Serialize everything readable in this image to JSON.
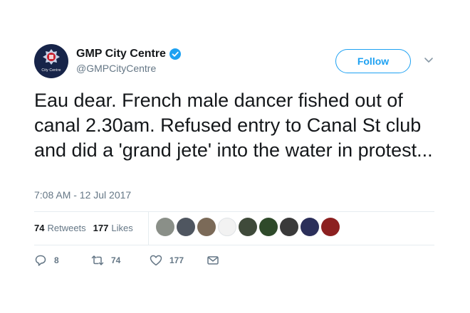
{
  "account": {
    "display_name": "GMP City Centre",
    "handle": "@GMPCityCentre",
    "avatar_text": "City Centre",
    "verified": true
  },
  "follow_button": {
    "label": "Follow"
  },
  "tweet": {
    "text": "Eau dear. French male dancer fished out of canal 2.30am. Refused entry to Canal St club and did a 'grand jete' into the water in protest...",
    "timestamp": "7:08 AM - 12 Jul 2017"
  },
  "stats": {
    "retweets_count": "74",
    "retweets_label": "Retweets",
    "likes_count": "177",
    "likes_label": "Likes"
  },
  "likers": [
    {
      "name": "liker-avatar-1",
      "color": "#8a8f88"
    },
    {
      "name": "liker-avatar-2",
      "color": "#4f5660"
    },
    {
      "name": "liker-avatar-3",
      "color": "#7b6a58"
    },
    {
      "name": "liker-avatar-4",
      "color": "#f2f2f2"
    },
    {
      "name": "liker-avatar-5",
      "color": "#3f4a3a"
    },
    {
      "name": "liker-avatar-6",
      "color": "#2f4a2a"
    },
    {
      "name": "liker-avatar-7",
      "color": "#3a3a3a"
    },
    {
      "name": "liker-avatar-8",
      "color": "#2b2f5a"
    },
    {
      "name": "liker-avatar-9",
      "color": "#8c2020"
    }
  ],
  "actions": {
    "reply_count": "8",
    "retweet_count": "74",
    "like_count": "177"
  },
  "colors": {
    "accent": "#1da1f2",
    "text": "#14171a",
    "muted": "#657786",
    "divider": "#e6ecf0"
  }
}
